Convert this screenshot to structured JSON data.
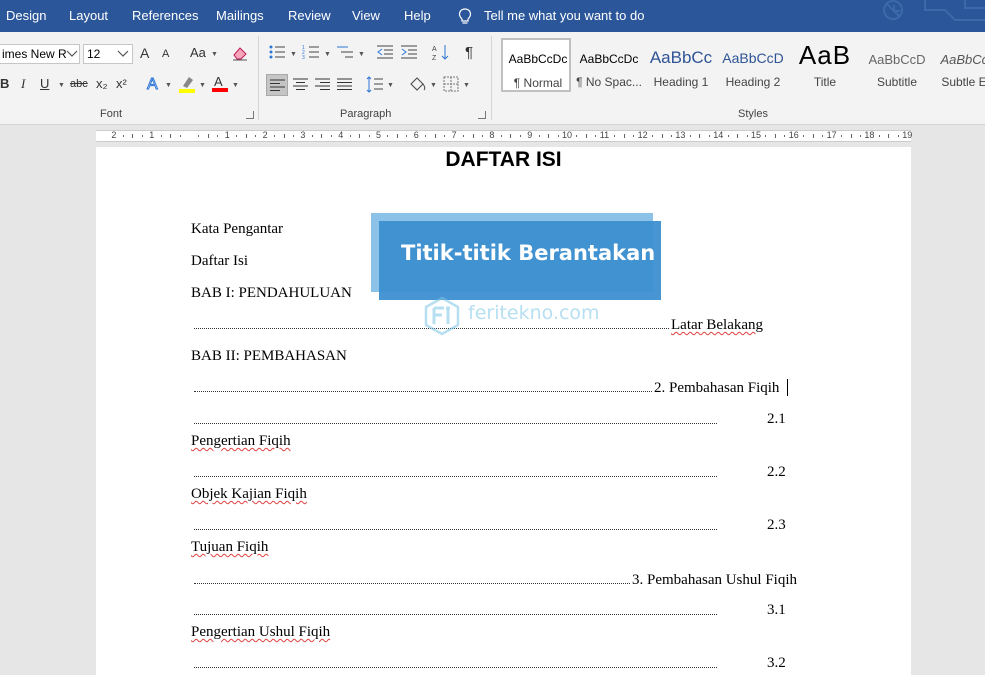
{
  "ribbon_tabs": [
    "Design",
    "Layout",
    "References",
    "Mailings",
    "Review",
    "View",
    "Help"
  ],
  "tell_me": "Tell me what you want to do",
  "font": {
    "name": "imes New R",
    "size": "12",
    "group_label": "Font",
    "grow": "A",
    "shrink": "A",
    "case": "Aa",
    "bold": "B",
    "italic": "I",
    "underline": "U",
    "strike": "abc",
    "subscript": "x₂",
    "superscript": "x²",
    "font_color": "A",
    "highlight_color": "#ffff00",
    "font_color_value": "#ff0000"
  },
  "paragraph": {
    "group_label": "Paragraph",
    "pilcrow": "¶"
  },
  "styles": {
    "group_label": "Styles",
    "items": [
      {
        "sample": "AaBbCcDc",
        "name": "¶ Normal"
      },
      {
        "sample": "AaBbCcDc",
        "name": "¶ No Spac..."
      },
      {
        "sample": "AaBbCc",
        "name": "Heading 1"
      },
      {
        "sample": "AaBbCcD",
        "name": "Heading 2"
      },
      {
        "sample": "AaB",
        "name": "Title"
      },
      {
        "sample": "AaBbCcD",
        "name": "Subtitle"
      },
      {
        "sample": "AaBbCcD",
        "name": "Subtle Em"
      }
    ]
  },
  "ruler": {
    "labels": [
      "2",
      "1",
      "1",
      "2",
      "3",
      "4",
      "5",
      "6",
      "7",
      "8",
      "9",
      "10",
      "11",
      "12",
      "13",
      "14",
      "15",
      "16",
      "17",
      "18",
      "19"
    ]
  },
  "document": {
    "title": "DAFTAR ISI",
    "lines": {
      "kata": "Kata Pengantar",
      "daftar": "Daftar Isi",
      "bab1": "BAB I: PENDAHULUAN",
      "latar": "Latar Belakang",
      "bab2": "BAB II: PEMBAHASAN",
      "p2": "2. Pembahasan Fiqih",
      "n21": "2.1",
      "pengertian_fiqih": "Pengertian Fiqih",
      "n22": "2.2",
      "objek": "Objek Kajian Fiqih",
      "n23": "2.3",
      "tujuan": "Tujuan Fiqih",
      "p3": "3. Pembahasan Ushul Fiqih",
      "n31": "3.1",
      "pengertian_ushul": "Pengertian Ushul Fiqih",
      "n32": "3.2"
    }
  },
  "overlay": {
    "banner_text": "Titik-titik Berantakan",
    "watermark": "feritekno.com"
  },
  "colors": {
    "ribbon_tab_bg": "#2b579a",
    "banner": "#3d8fd0",
    "spell_underline": "#e04040"
  }
}
